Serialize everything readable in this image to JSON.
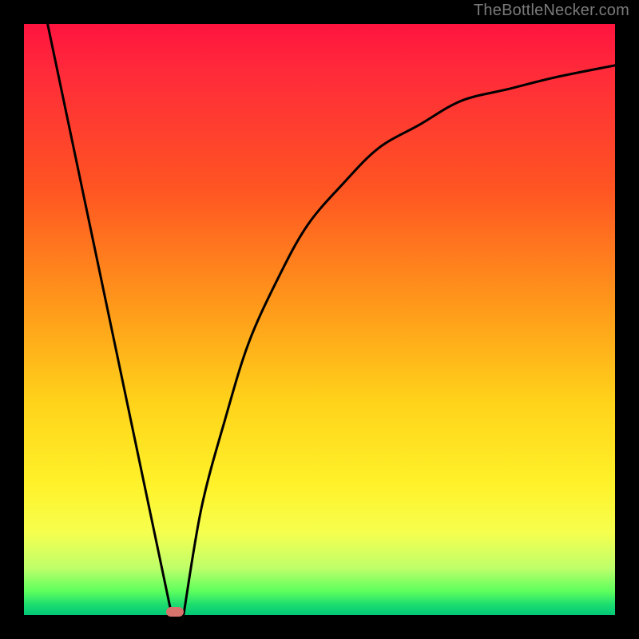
{
  "watermark": "TheBottleNecker.com",
  "chart_data": {
    "type": "line",
    "title": "",
    "xlabel": "",
    "ylabel": "",
    "xlim": [
      0,
      1
    ],
    "ylim": [
      0,
      1
    ],
    "series": [
      {
        "name": "left-line",
        "x": [
          0.04,
          0.25
        ],
        "y": [
          1.0,
          0.0
        ]
      },
      {
        "name": "right-curve",
        "x": [
          0.27,
          0.3,
          0.34,
          0.38,
          0.43,
          0.48,
          0.54,
          0.6,
          0.67,
          0.74,
          0.82,
          0.9,
          1.0
        ],
        "y": [
          0.0,
          0.18,
          0.33,
          0.46,
          0.57,
          0.66,
          0.73,
          0.79,
          0.83,
          0.87,
          0.89,
          0.91,
          0.93
        ]
      }
    ],
    "marker": {
      "x": 0.255,
      "y": 0.005,
      "color": "#d6736c"
    },
    "gradient_stops": [
      {
        "pos": 0.0,
        "color": "#ff143f"
      },
      {
        "pos": 0.5,
        "color": "#ffb020"
      },
      {
        "pos": 0.8,
        "color": "#fff22a"
      },
      {
        "pos": 1.0,
        "color": "#00c878"
      }
    ]
  }
}
